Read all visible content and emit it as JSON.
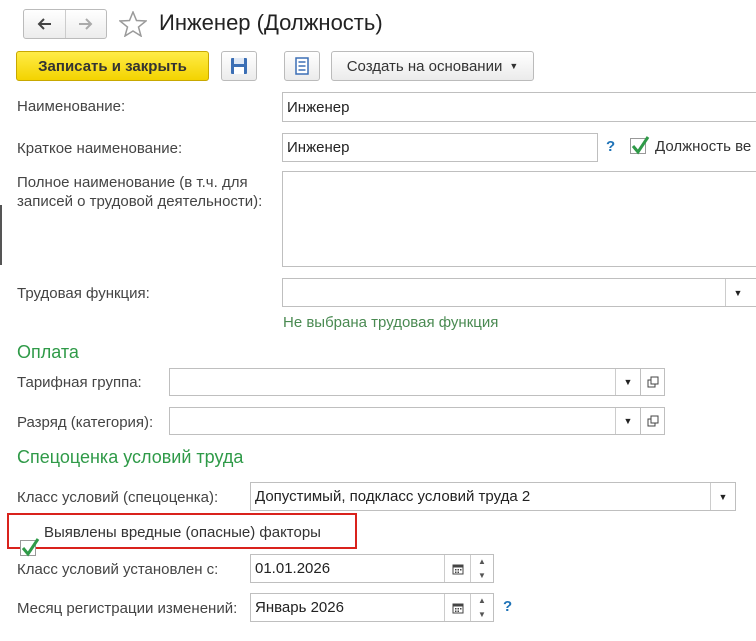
{
  "window": {
    "title": "Инженер (Должность)"
  },
  "toolbar": {
    "save_close_label": "Записать и закрыть",
    "create_based_label": "Создать на основании"
  },
  "form": {
    "name_label": "Наименование:",
    "name_value": "Инженер",
    "short_name_label": "Краткое наименование:",
    "short_name_value": "Инженер",
    "help_mark": "?",
    "position_checkbox_label": "Должность ве",
    "full_name_label_line1": "Полное наименование (в т.ч. для",
    "full_name_label_line2": "записей о трудовой деятельности):",
    "full_name_value": "",
    "labor_function_label": "Трудовая функция:",
    "labor_function_value": "",
    "labor_function_hint": "Не выбрана трудовая функция"
  },
  "payment": {
    "section_title": "Оплата",
    "tariff_group_label": "Тарифная группа:",
    "tariff_group_value": "",
    "grade_label": "Разряд (категория):",
    "grade_value": ""
  },
  "special_assessment": {
    "section_title": "Спецоценка условий труда",
    "class_label": "Класс условий (спецоценка):",
    "class_value": "Допустимый, подкласс условий труда 2",
    "harmful_factors_label": "Выявлены вредные (опасные) факторы",
    "harmful_factors_checked": true,
    "class_set_from_label": "Класс условий установлен с:",
    "class_set_from_value": "01.01.2026",
    "registration_month_label": "Месяц регистрации изменений:",
    "registration_month_value": "Январь 2026",
    "help_mark": "?"
  },
  "icons": [
    "back-arrow-icon",
    "forward-arrow-icon",
    "star-icon",
    "floppy-disk-icon",
    "document-list-icon",
    "chevron-down-icon",
    "open-window-icon",
    "calendar-icon",
    "checkmark-icon"
  ],
  "colors": {
    "primary_button": "#f3d300",
    "section_title": "#2f9a48",
    "checkmark": "#2f9a48",
    "highlight_border": "#d9221c",
    "help": "#1f73b7"
  }
}
